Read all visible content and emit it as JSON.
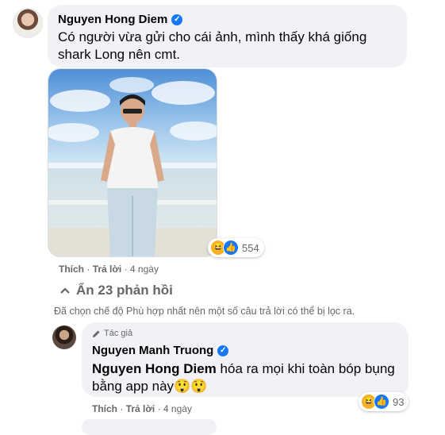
{
  "comment1": {
    "author": "Nguyen Hong Diem",
    "text": "Có người vừa gửi cho cái ảnh, mình thấy khá giống shark Long nên cmt.",
    "reactions_count": "554",
    "actions": {
      "like": "Thích",
      "reply": "Trả lời",
      "time": "4 ngày"
    }
  },
  "hidden_replies": {
    "label": "Ẩn 23 phản hồi",
    "note": "Đã chọn chế độ Phù hợp nhất nên một số câu trả lời có thể bị lọc ra."
  },
  "reply1": {
    "badge": "Tác giả",
    "author": "Nguyen Manh Truong",
    "mention": "Nguyen Hong Diem",
    "text": "hóa ra mọi khi toàn bóp bụng bằng app này😲😲",
    "reactions_count": "93",
    "actions": {
      "like": "Thích",
      "reply": "Trả lời",
      "time": "4 ngày"
    }
  },
  "icons": {
    "verified": "verified-check-icon",
    "haha": "haha-reaction-icon",
    "like": "like-reaction-icon",
    "chevron": "chevron-up-icon",
    "pencil": "pencil-icon"
  },
  "colors": {
    "bubble": "#f0f2f5",
    "verified": "#1877f2",
    "secondary_text": "#65676b"
  }
}
